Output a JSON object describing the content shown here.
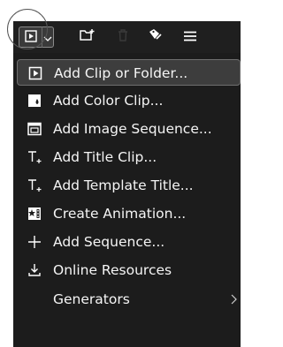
{
  "toolbar": {
    "buttons": [
      {
        "name": "add-clip",
        "icon": "add-clip-icon"
      },
      {
        "name": "dropdown",
        "icon": "chevron-down-icon"
      },
      {
        "name": "new-folder",
        "icon": "folder-plus-icon"
      },
      {
        "name": "delete",
        "icon": "trash-icon",
        "disabled": true
      },
      {
        "name": "tag",
        "icon": "tag-icon"
      },
      {
        "name": "menu",
        "icon": "hamburger-icon"
      }
    ]
  },
  "menu": {
    "items": [
      {
        "label": "Add Clip or Folder...",
        "icon": "add-clip-icon",
        "selected": true
      },
      {
        "label": "Add Color Clip...",
        "icon": "color-clip-icon"
      },
      {
        "label": "Add Image Sequence...",
        "icon": "image-sequence-icon"
      },
      {
        "label": "Add Title Clip...",
        "icon": "title-clip-icon"
      },
      {
        "label": "Add Template Title...",
        "icon": "template-title-icon"
      },
      {
        "label": "Create Animation...",
        "icon": "animation-icon"
      },
      {
        "label": "Add Sequence...",
        "icon": "plus-icon"
      },
      {
        "label": "Online Resources",
        "icon": "download-icon"
      },
      {
        "label": "Generators",
        "icon": "",
        "submenu": true
      }
    ]
  },
  "colors": {
    "toolbar_bg": "#1f1f1f",
    "menu_bg": "#1c1c1c",
    "selected_bg": "#3d3d3d",
    "text": "#f5f5f5"
  }
}
